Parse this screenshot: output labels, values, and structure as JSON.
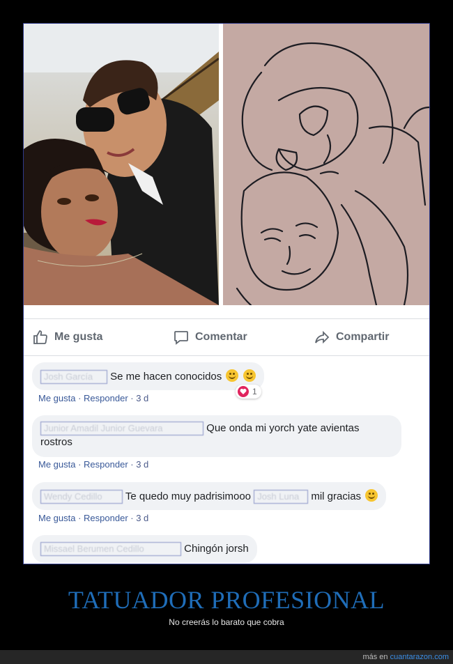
{
  "post": {
    "actions": [
      {
        "label": "Me gusta",
        "icon": "like-thumb-icon"
      },
      {
        "label": "Comentar",
        "icon": "comment-bubble-icon"
      },
      {
        "label": "Compartir",
        "icon": "share-arrow-icon"
      }
    ]
  },
  "comments": [
    {
      "author": "Josh García",
      "text": "Se me hacen conocidos",
      "emojis": "rolling-on-floor-laughing-icon x2",
      "like": "Me gusta",
      "reply": "Responder",
      "time": "3 d",
      "reaction_count": "1"
    },
    {
      "author": "Junior Amadil Junior Guevara",
      "text_line1": "Que onda mi yorch yate avientas",
      "text_line2": "rostros",
      "like": "Me gusta",
      "reply": "Responder",
      "time": "3 d"
    },
    {
      "author": "Wendy Cedillo",
      "text": "Te quedo muy padrisimooo",
      "mention": "Josh Luna",
      "text2": "mil gracias",
      "like": "Me gusta",
      "reply": "Responder",
      "time": "3 d"
    },
    {
      "author": "Missael Berumen Cedillo",
      "text": "Chingón jorsh"
    }
  ],
  "caption": {
    "title": "TATUADOR PROFESIONAL",
    "subtitle": "No creerás lo barato que cobra"
  },
  "footer": {
    "prefix": "más en",
    "link": "cuantarazon.com"
  },
  "colors": {
    "accent_title": "#1f6db8",
    "link": "#385898",
    "heart": "#e0245e"
  }
}
